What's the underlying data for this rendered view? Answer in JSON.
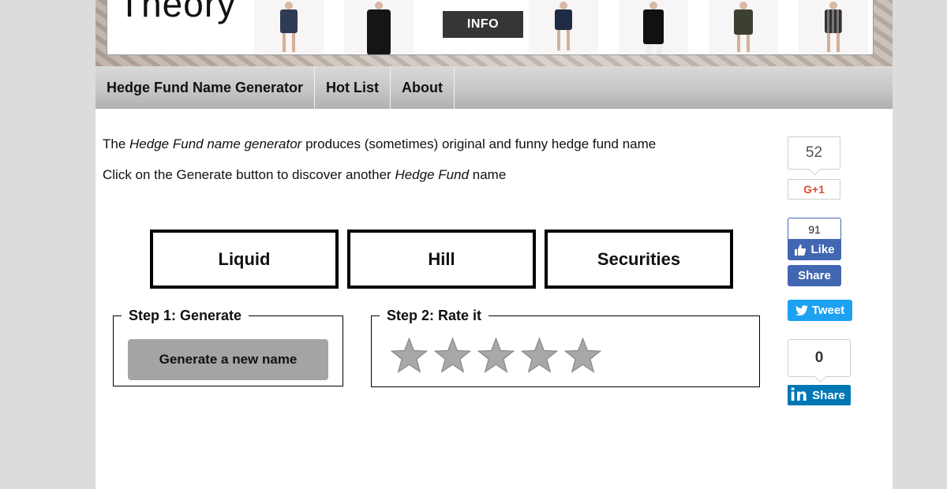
{
  "banner": {
    "brand": "Theory",
    "info_label": "INFO"
  },
  "nav": {
    "items": [
      {
        "label": "Hedge Fund Name Generator"
      },
      {
        "label": "Hot List"
      },
      {
        "label": "About"
      }
    ]
  },
  "intro": {
    "line1_prefix": "The ",
    "line1_em": "Hedge Fund name generator",
    "line1_suffix": " produces (sometimes) original and funny hedge fund name",
    "line2_prefix": "Click on the Generate button to discover another ",
    "line2_em": "Hedge Fund",
    "line2_suffix": " name"
  },
  "name_words": [
    "Liquid",
    "Hill",
    "Securities"
  ],
  "step1": {
    "legend": "Step 1: Generate",
    "button_label": "Generate a new name"
  },
  "step2": {
    "legend": "Step 2: Rate it",
    "star_count": 5,
    "star_color": "#a8a8a8"
  },
  "share": {
    "gplus_count": "52",
    "gplus_label": "G+1",
    "fb_count": "91",
    "fb_like_label": "Like",
    "fb_share_label": "Share",
    "tweet_label": "Tweet",
    "linkedin_count": "0",
    "linkedin_logo": "in",
    "linkedin_share_label": "Share",
    "colors": {
      "facebook": "#4267b2",
      "twitter": "#1da1f2",
      "linkedin": "#0077b5",
      "gplus": "#dd4b39"
    }
  }
}
